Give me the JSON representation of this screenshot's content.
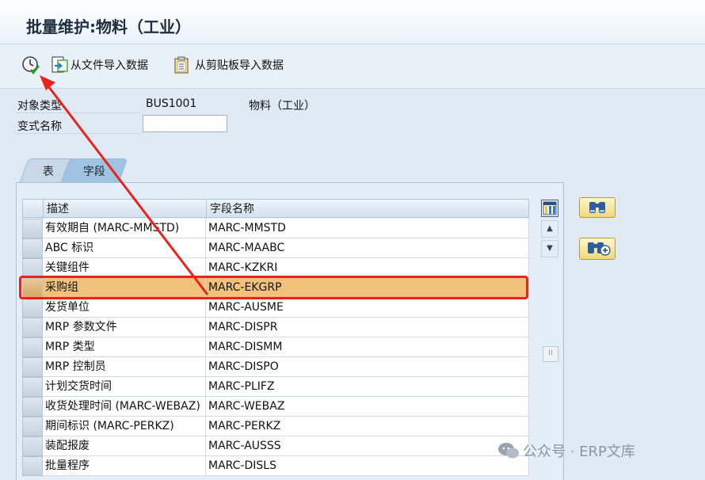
{
  "window": {
    "title": "批量维护:物料（工业）"
  },
  "toolbar": {
    "import_file_label": "从文件导入数据",
    "import_clipboard_label": "从剪贴板导入数据"
  },
  "header_fields": {
    "object_type_label": "对象类型",
    "object_type_value": "BUS1001",
    "object_type_desc": "物料（工业）",
    "variant_label": "变式名称",
    "variant_value": ""
  },
  "tabs": [
    {
      "label": "表"
    },
    {
      "label": "字段"
    }
  ],
  "table": {
    "columns": [
      "描述",
      "字段名称"
    ],
    "rows": [
      {
        "desc": "有效期自 (MARC-MMSTD)",
        "field": "MARC-MMSTD"
      },
      {
        "desc": "ABC 标识",
        "field": "MARC-MAABC"
      },
      {
        "desc": "关键组件",
        "field": "MARC-KZKRI"
      },
      {
        "desc": "采购组",
        "field": "MARC-EKGRP"
      },
      {
        "desc": "发货单位",
        "field": "MARC-AUSME"
      },
      {
        "desc": "MRP 参数文件",
        "field": "MARC-DISPR"
      },
      {
        "desc": "MRP 类型",
        "field": "MARC-DISMM"
      },
      {
        "desc": "MRP 控制员",
        "field": "MARC-DISPO"
      },
      {
        "desc": "计划交货时间",
        "field": "MARC-PLIFZ"
      },
      {
        "desc": "收货处理时间 (MARC-WEBAZ)",
        "field": "MARC-WEBAZ"
      },
      {
        "desc": "期间标识 (MARC-PERKZ)",
        "field": "MARC-PERKZ"
      },
      {
        "desc": "装配报废",
        "field": "MARC-AUSSS"
      },
      {
        "desc": "批量程序",
        "field": "MARC-DISLS"
      }
    ],
    "highlighted_row": "采购组"
  },
  "watermark": {
    "text": "公众号 · ERP文库"
  },
  "colors": {
    "highlight_row": "#f0c27a",
    "annotation_red": "#e8231c"
  }
}
